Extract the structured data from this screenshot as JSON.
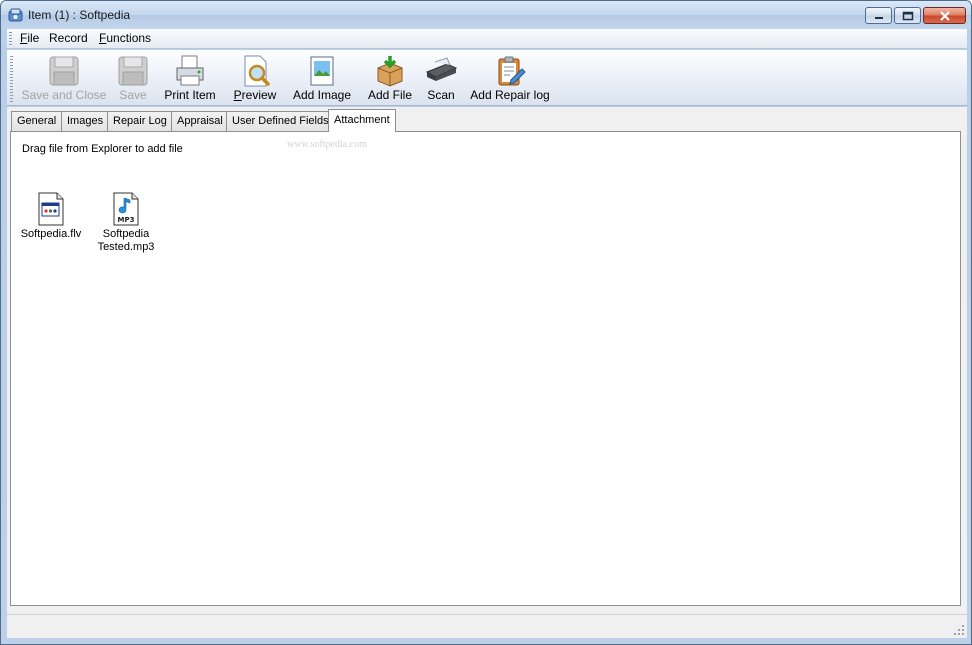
{
  "window": {
    "title": "Item (1) : Softpedia"
  },
  "menu": [
    {
      "mnemonic": "F",
      "rest": "ile"
    },
    {
      "mnemonic": "",
      "rest": "Record"
    },
    {
      "mnemonic": "F",
      "rest": "unctions"
    }
  ],
  "toolbar": {
    "save_close": "Save and Close",
    "save": "Save",
    "print_item": "Print Item",
    "preview_m": "P",
    "preview_rest": "review",
    "add_image": "Add Image",
    "add_file": "Add File",
    "scan": "Scan",
    "add_repair_log": "Add Repair log"
  },
  "tabs": [
    "General",
    "Images",
    "Repair Log",
    "Appraisal",
    "User Defined Fields",
    "Attachment"
  ],
  "attachment": {
    "hint": "Drag file from Explorer to add file",
    "watermark": "www.softpedia.com",
    "files": [
      {
        "line1": "Softpedia.flv",
        "line2": ""
      },
      {
        "line1": "Softpedia",
        "line2": "Tested.mp3",
        "badge": "MP3"
      }
    ]
  }
}
